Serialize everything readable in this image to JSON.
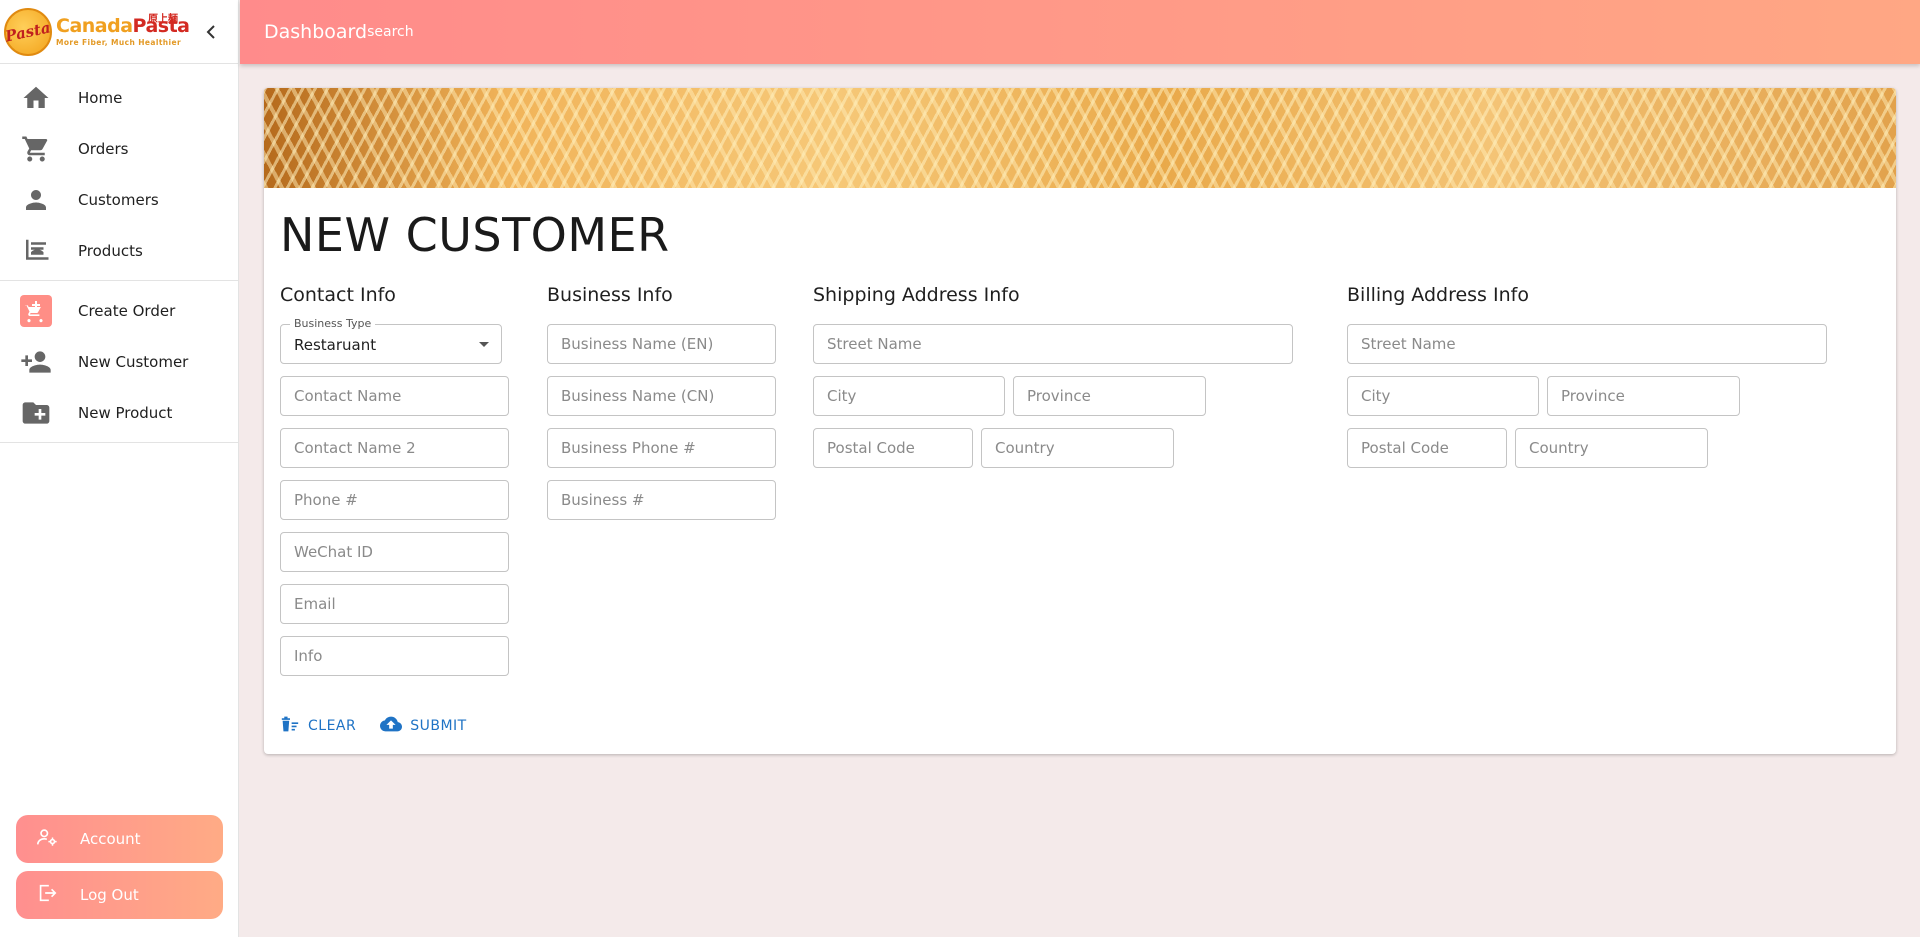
{
  "brand": {
    "badge_text": "Pasta",
    "name_part1": "Canada",
    "name_part2": "Pasta",
    "name_cn": "原上麺",
    "tagline": "More Fiber, Much Healthier"
  },
  "sidebar": {
    "primary": [
      {
        "label": "Home",
        "icon": "home-icon"
      },
      {
        "label": "Orders",
        "icon": "cart-icon"
      },
      {
        "label": "Customers",
        "icon": "person-icon"
      },
      {
        "label": "Products",
        "icon": "products-icon"
      }
    ],
    "secondary": [
      {
        "label": "Create Order",
        "icon": "add-cart-icon"
      },
      {
        "label": "New Customer",
        "icon": "person-add-icon"
      },
      {
        "label": "New Product",
        "icon": "folder-add-icon"
      }
    ],
    "account_label": "Account",
    "logout_label": "Log Out"
  },
  "header": {
    "breadcrumb": "Dashboard",
    "search_label": "search"
  },
  "page": {
    "title": "NEW CUSTOMER"
  },
  "contact": {
    "title": "Contact Info",
    "business_type_label": "Business Type",
    "business_type_value": "Restaruant",
    "contact_name": "Contact Name",
    "contact_name_2": "Contact Name 2",
    "phone": "Phone #",
    "wechat": "WeChat ID",
    "email": "Email",
    "info": "Info"
  },
  "business": {
    "title": "Business Info",
    "name_en": "Business Name (EN)",
    "name_cn": "Business Name (CN)",
    "phone": "Business Phone #",
    "number": "Business #"
  },
  "shipping": {
    "title": "Shipping Address Info",
    "street": "Street Name",
    "city": "City",
    "province": "Province",
    "postal": "Postal Code",
    "country": "Country"
  },
  "billing": {
    "title": "Billing Address Info",
    "street": "Street Name",
    "city": "City",
    "province": "Province",
    "postal": "Postal Code",
    "country": "Country"
  },
  "actions": {
    "clear": "CLEAR",
    "submit": "SUBMIT"
  },
  "colors": {
    "accent_gradient_start": "#ff8b8b",
    "accent_gradient_end": "#ffa784",
    "action_blue": "#1f73c5",
    "background": "#f4eaea"
  }
}
